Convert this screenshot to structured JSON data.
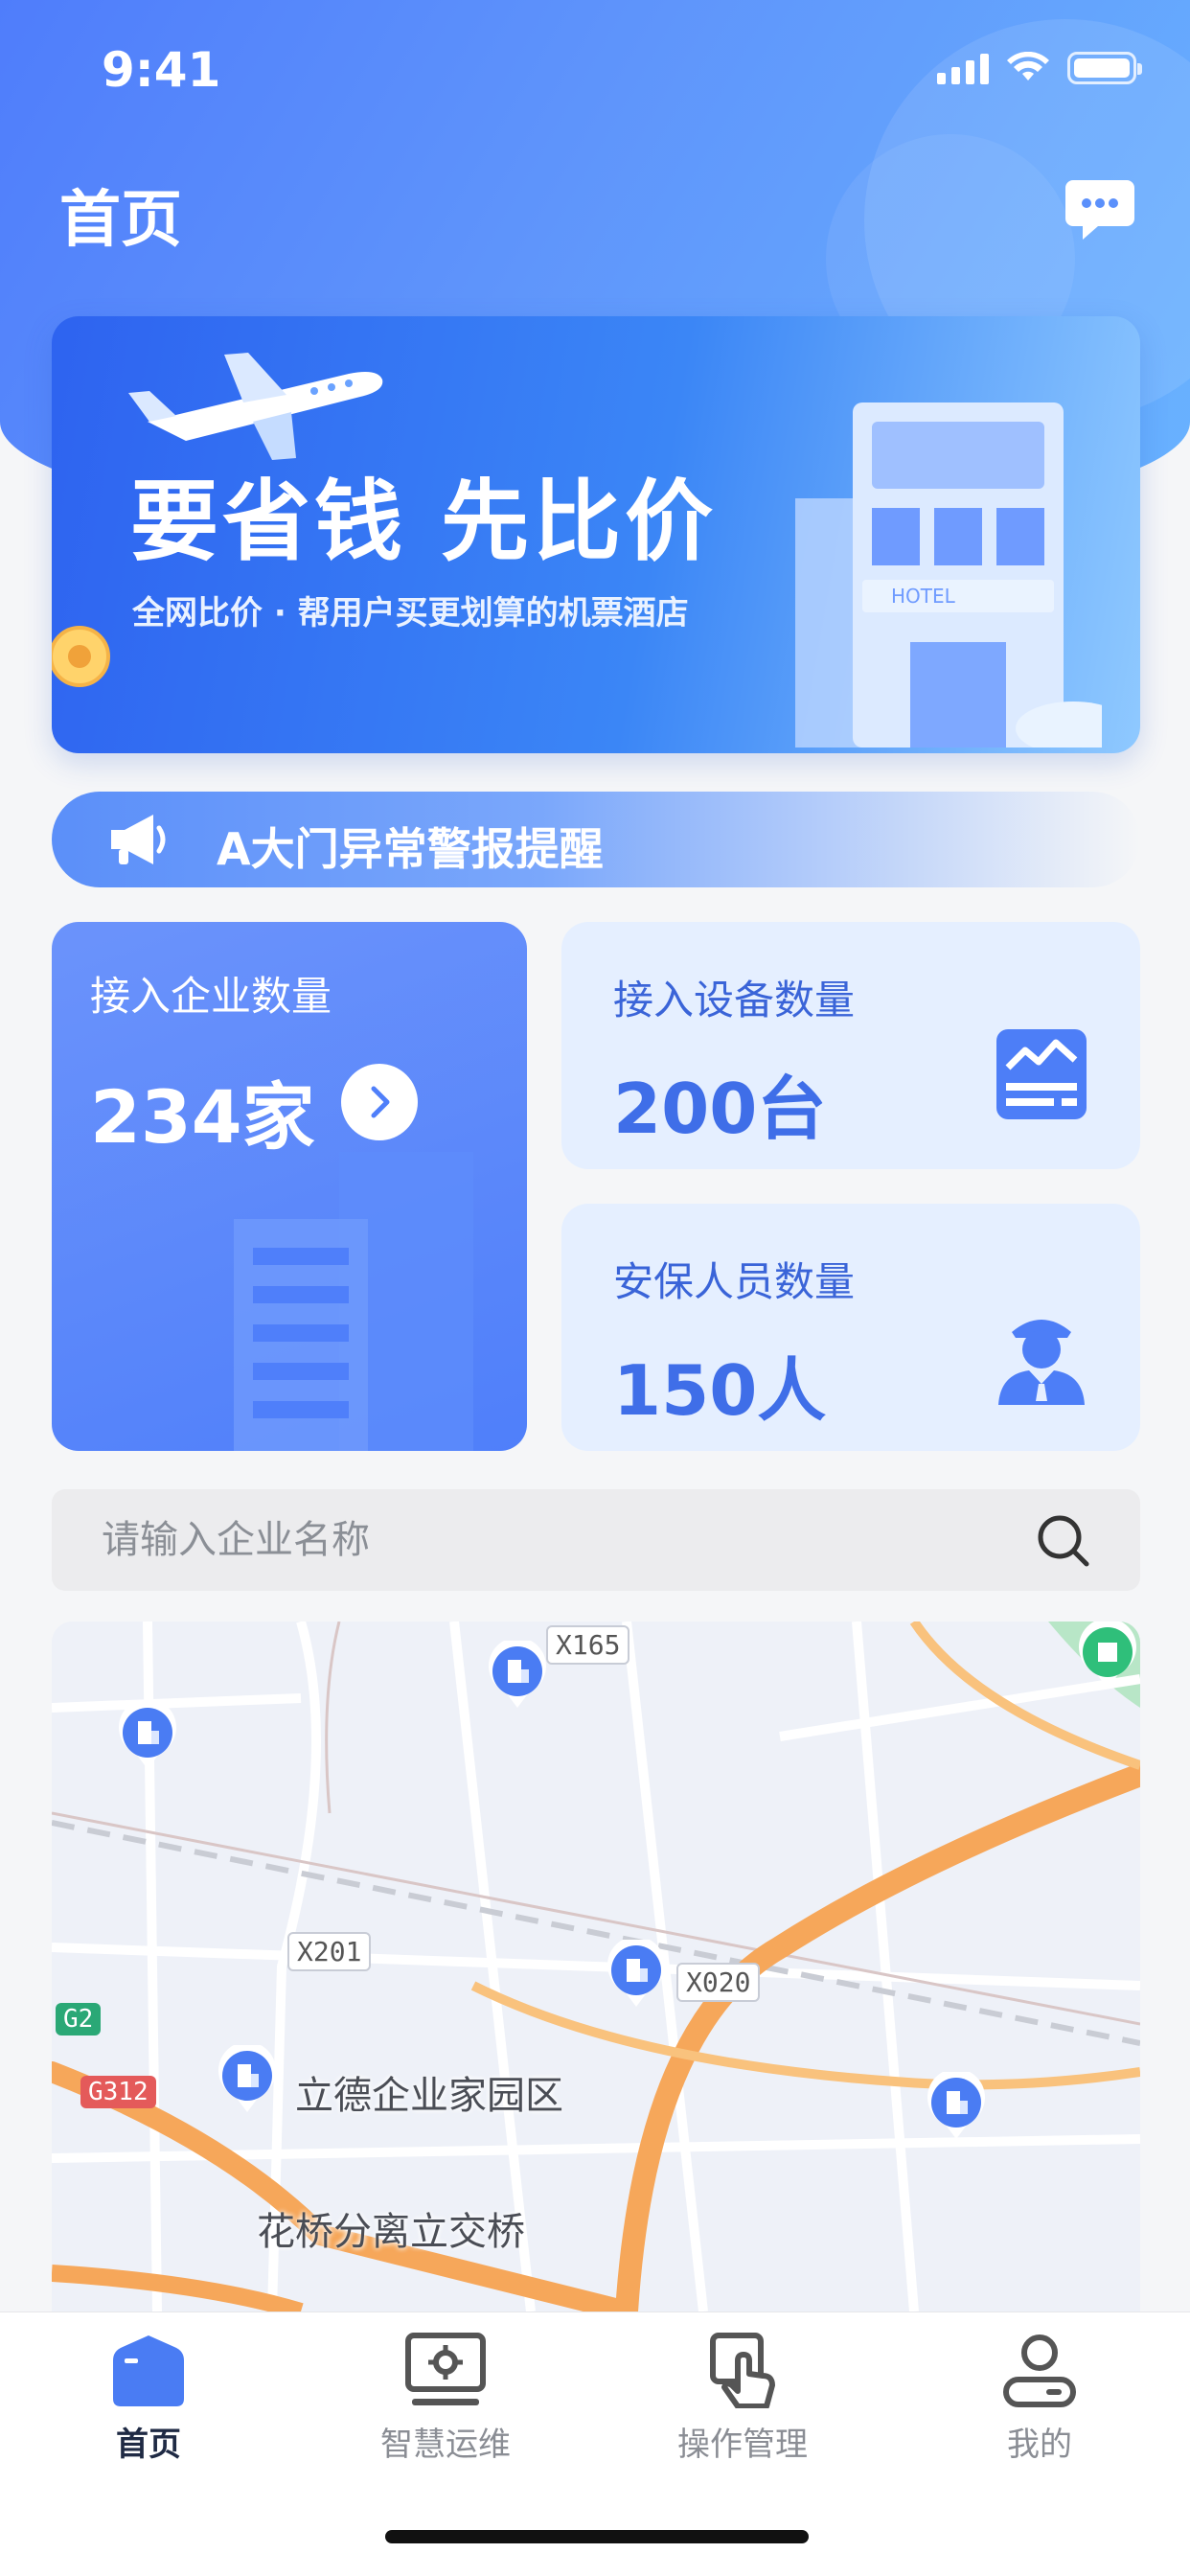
{
  "status_bar": {
    "time": "9:41"
  },
  "header": {
    "title": "首页"
  },
  "banner": {
    "title": "要省钱 先比价",
    "subtitle": "全网比价 · 帮用户买更划算的机票酒店",
    "hotel_sign": "HOTEL"
  },
  "alert": {
    "text": "A大门异常警报提醒"
  },
  "stats": {
    "enterprises": {
      "label": "接入企业数量",
      "value": "234家"
    },
    "devices": {
      "label": "接入设备数量",
      "value": "200台"
    },
    "security": {
      "label": "安保人员数量",
      "value": "150人"
    }
  },
  "search": {
    "placeholder": "请输入企业名称",
    "value": ""
  },
  "map": {
    "road_labels": [
      "X165",
      "X201",
      "X020"
    ],
    "highway_labels": [
      "G2",
      "G312"
    ],
    "places": [
      "立德企业家园区",
      "花桥分离立交桥"
    ]
  },
  "tabs": [
    {
      "label": "首页",
      "icon": "home-icon",
      "active": true
    },
    {
      "label": "智慧运维",
      "icon": "monitor-gear-icon",
      "active": false
    },
    {
      "label": "操作管理",
      "icon": "touch-hand-icon",
      "active": false
    },
    {
      "label": "我的",
      "icon": "user-icon",
      "active": false
    }
  ],
  "colors": {
    "primary": "#4f7ffa",
    "card_light": "#e5efff",
    "alert_gradient_start": "#5b8ff9",
    "map_road_major": "#f6a75a",
    "tab_active": "#1f2a44",
    "tab_inactive": "#8a8d94"
  }
}
